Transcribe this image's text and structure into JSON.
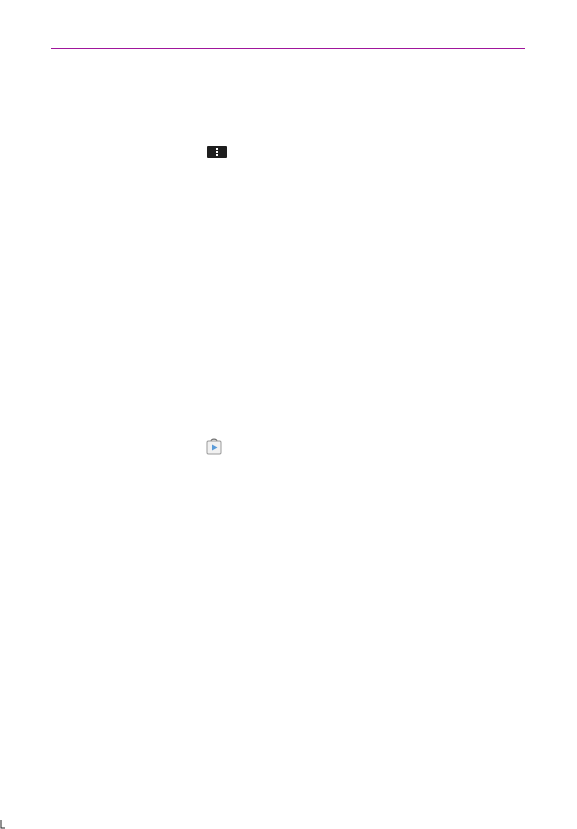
{
  "document": {
    "rule_color": "#a0169c"
  },
  "icons": {
    "inline_menu": "menu-overflow-icon",
    "inline_app": "play-store-icon"
  }
}
